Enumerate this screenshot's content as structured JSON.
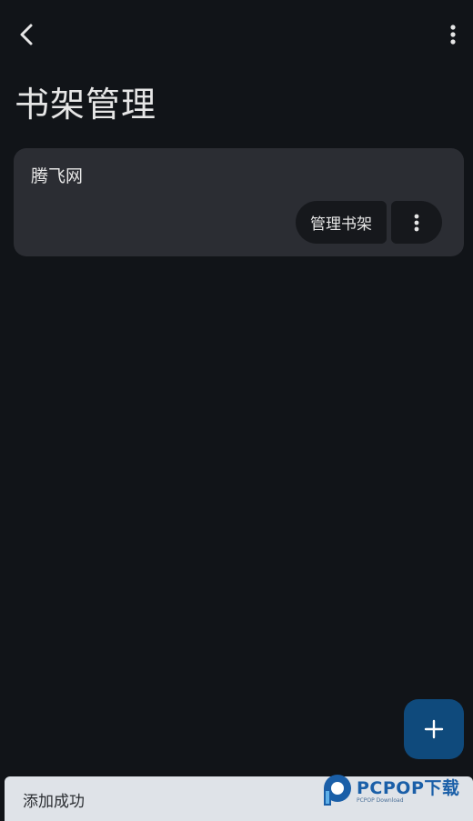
{
  "header": {
    "back_icon": "chevron-left-icon",
    "overflow_icon": "more-vert-icon"
  },
  "page": {
    "title": "书架管理"
  },
  "shelves": [
    {
      "name": "腾飞网",
      "manage_label": "管理书架",
      "more_icon": "more-vert-icon"
    }
  ],
  "fab": {
    "icon": "plus-icon",
    "color": "#0f4a7c"
  },
  "snackbar": {
    "message": "添加成功"
  },
  "watermark": {
    "brand": "PCPOP下载",
    "tagline": "PCPOP Download"
  },
  "colors": {
    "background": "#111418",
    "card": "#2b2d33",
    "button": "#16181c",
    "snackbar": "#dfe3e8",
    "brand": "#1a5fa8"
  }
}
